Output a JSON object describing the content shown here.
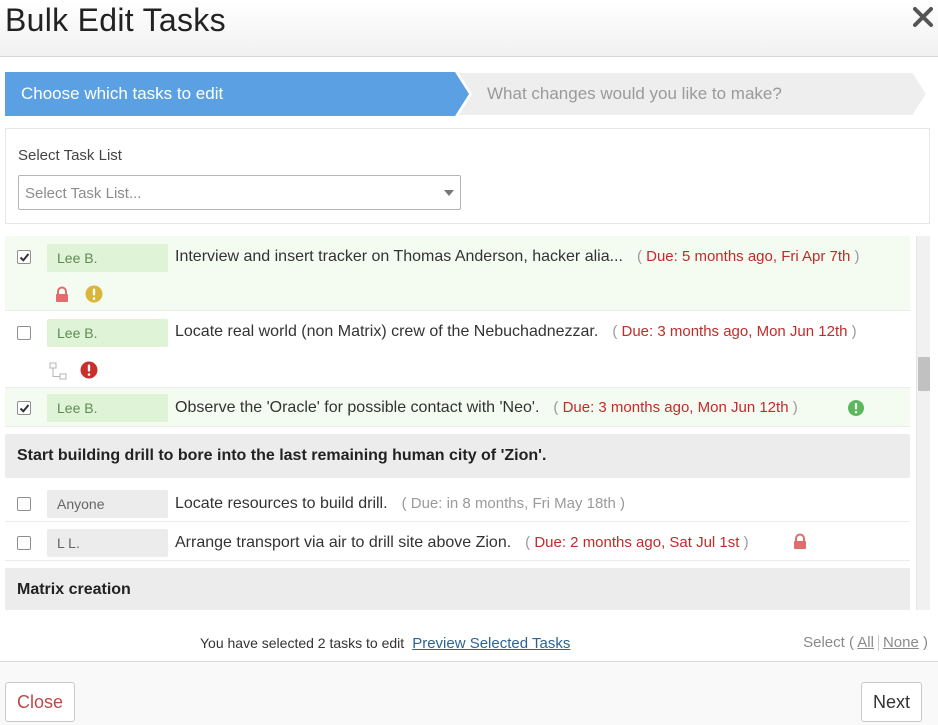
{
  "dialog": {
    "title": "Bulk Edit Tasks",
    "close_icon": "close-icon"
  },
  "wizard": {
    "steps": [
      {
        "label": "Choose which tasks to edit",
        "active": true,
        "color": "#5ba0e3"
      },
      {
        "label": "What changes would you like to make?",
        "active": false,
        "color": "#eeeeee"
      }
    ]
  },
  "task_list_select": {
    "label": "Select Task List",
    "placeholder": "Select Task List..."
  },
  "tasks": [
    {
      "checked": true,
      "assignee": "Lee B.",
      "name": "Interview and insert tracker on Thomas Anderson, hacker alia...",
      "due": "Due: 5 months ago, Fri Apr 7th",
      "due_status": "overdue",
      "icons": [
        "lock-icon",
        "warning-yellow-icon"
      ]
    },
    {
      "checked": false,
      "assignee": "Lee B.",
      "name": "Locate real world (non Matrix) crew of the Nebuchadnezzar.",
      "due": "Due: 3 months ago, Mon Jun 12th",
      "due_status": "overdue",
      "icons": [
        "subtask-icon",
        "warning-red-icon"
      ]
    },
    {
      "checked": true,
      "assignee": "Lee B.",
      "name": "Observe the 'Oracle' for possible contact with 'Neo'.",
      "due": "Due: 3 months ago, Mon Jun 12th",
      "due_status": "overdue",
      "icons": [
        "priority-green-icon"
      ]
    }
  ],
  "groups": [
    {
      "title": "Start building drill to bore into the last remaining human city of 'Zion'.",
      "tasks": [
        {
          "checked": false,
          "assignee": "Anyone",
          "name": "Locate resources to build drill.",
          "due": "Due: in 8 months, Fri May 18th",
          "due_status": "upcoming",
          "icons": []
        },
        {
          "checked": false,
          "assignee": "L L.",
          "name": "Arrange transport via air to drill site above Zion.",
          "due": "Due: 2 months ago, Sat Jul 1st",
          "due_status": "overdue",
          "icons": [
            "lock-icon"
          ]
        }
      ]
    },
    {
      "title": "Matrix creation",
      "tasks": []
    }
  ],
  "footer": {
    "selection_text": "You have selected 2 tasks to edit",
    "preview_link": "Preview Selected Tasks",
    "select_prefix": "Select (",
    "select_all": "All",
    "select_none": "None",
    "select_suffix": ")"
  },
  "buttons": {
    "close": "Close",
    "next": "Next"
  },
  "colors": {
    "overdue": "#c32b2b",
    "upcoming": "#9a9a9a",
    "lock": "#e06c6c",
    "warning_yellow": "#d9b53c",
    "warning_red": "#c9302c",
    "priority_green": "#5cb85c"
  }
}
